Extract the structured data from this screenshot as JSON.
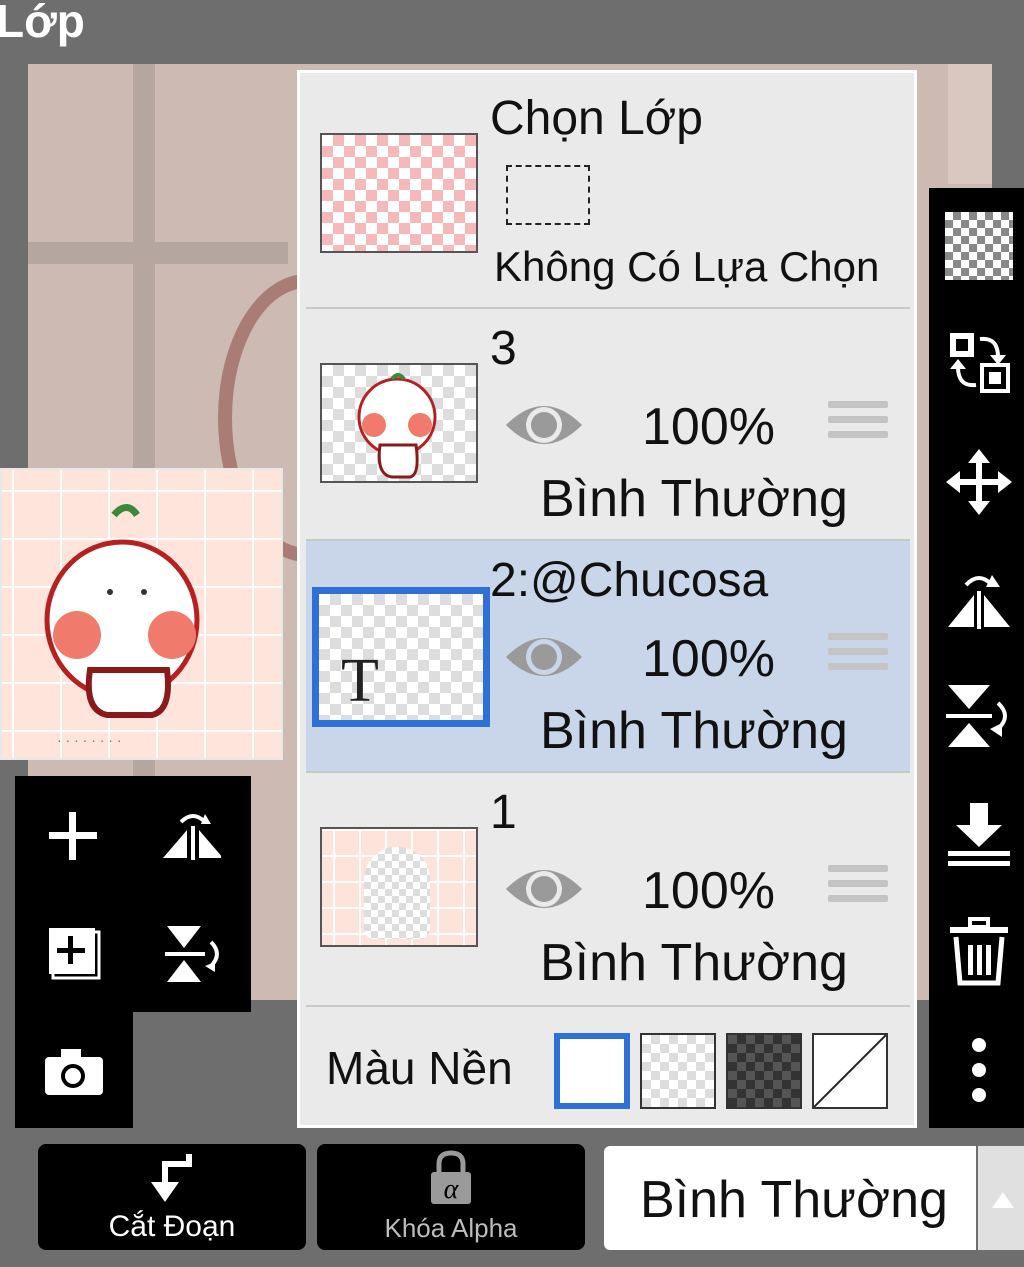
{
  "title": "Lớp",
  "selection": {
    "label": "Chọn Lớp",
    "status": "Không Có Lựa Chọn"
  },
  "layers": [
    {
      "name": "3",
      "opacity": "100%",
      "blend": "Bình Thường",
      "selected": false
    },
    {
      "name": "2:@Chucosa",
      "opacity": "100%",
      "blend": "Bình Thường",
      "selected": true,
      "thumb_text": "T"
    },
    {
      "name": "1",
      "opacity": "100%",
      "blend": "Bình Thường",
      "selected": false
    }
  ],
  "background": {
    "label": "Màu Nền",
    "options": [
      "white",
      "checker-light",
      "checker-dark",
      "none"
    ],
    "selected": "white"
  },
  "bottom": {
    "clip_label": "Cắt Đoạn",
    "alpha_lock_label": "Khóa Alpha",
    "alpha_lock_glyph": "α",
    "blend_mode": "Bình Thường"
  },
  "colors": {
    "accent": "#2f6fd8",
    "selected_row": "#c9d6ea",
    "panel": "#eaeaea"
  },
  "icons": {
    "left_tools": [
      "add-layer-icon",
      "flip-horizontal-icon",
      "duplicate-layer-icon",
      "flip-vertical-icon",
      "camera-icon"
    ],
    "right_tools": [
      "transparency-icon",
      "swap-layer-icon",
      "move-icon",
      "flip-horizontal-icon",
      "flip-vertical-icon",
      "merge-down-icon",
      "trash-icon",
      "more-icon"
    ]
  }
}
